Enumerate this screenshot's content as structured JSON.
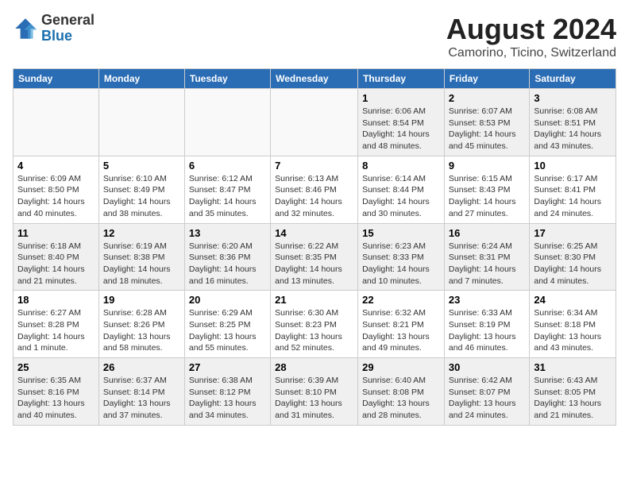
{
  "logo": {
    "general": "General",
    "blue": "Blue"
  },
  "title": "August 2024",
  "location": "Camorino, Ticino, Switzerland",
  "weekdays": [
    "Sunday",
    "Monday",
    "Tuesday",
    "Wednesday",
    "Thursday",
    "Friday",
    "Saturday"
  ],
  "weeks": [
    [
      {
        "day": "",
        "info": ""
      },
      {
        "day": "",
        "info": ""
      },
      {
        "day": "",
        "info": ""
      },
      {
        "day": "",
        "info": ""
      },
      {
        "day": "1",
        "info": "Sunrise: 6:06 AM\nSunset: 8:54 PM\nDaylight: 14 hours\nand 48 minutes."
      },
      {
        "day": "2",
        "info": "Sunrise: 6:07 AM\nSunset: 8:53 PM\nDaylight: 14 hours\nand 45 minutes."
      },
      {
        "day": "3",
        "info": "Sunrise: 6:08 AM\nSunset: 8:51 PM\nDaylight: 14 hours\nand 43 minutes."
      }
    ],
    [
      {
        "day": "4",
        "info": "Sunrise: 6:09 AM\nSunset: 8:50 PM\nDaylight: 14 hours\nand 40 minutes."
      },
      {
        "day": "5",
        "info": "Sunrise: 6:10 AM\nSunset: 8:49 PM\nDaylight: 14 hours\nand 38 minutes."
      },
      {
        "day": "6",
        "info": "Sunrise: 6:12 AM\nSunset: 8:47 PM\nDaylight: 14 hours\nand 35 minutes."
      },
      {
        "day": "7",
        "info": "Sunrise: 6:13 AM\nSunset: 8:46 PM\nDaylight: 14 hours\nand 32 minutes."
      },
      {
        "day": "8",
        "info": "Sunrise: 6:14 AM\nSunset: 8:44 PM\nDaylight: 14 hours\nand 30 minutes."
      },
      {
        "day": "9",
        "info": "Sunrise: 6:15 AM\nSunset: 8:43 PM\nDaylight: 14 hours\nand 27 minutes."
      },
      {
        "day": "10",
        "info": "Sunrise: 6:17 AM\nSunset: 8:41 PM\nDaylight: 14 hours\nand 24 minutes."
      }
    ],
    [
      {
        "day": "11",
        "info": "Sunrise: 6:18 AM\nSunset: 8:40 PM\nDaylight: 14 hours\nand 21 minutes."
      },
      {
        "day": "12",
        "info": "Sunrise: 6:19 AM\nSunset: 8:38 PM\nDaylight: 14 hours\nand 18 minutes."
      },
      {
        "day": "13",
        "info": "Sunrise: 6:20 AM\nSunset: 8:36 PM\nDaylight: 14 hours\nand 16 minutes."
      },
      {
        "day": "14",
        "info": "Sunrise: 6:22 AM\nSunset: 8:35 PM\nDaylight: 14 hours\nand 13 minutes."
      },
      {
        "day": "15",
        "info": "Sunrise: 6:23 AM\nSunset: 8:33 PM\nDaylight: 14 hours\nand 10 minutes."
      },
      {
        "day": "16",
        "info": "Sunrise: 6:24 AM\nSunset: 8:31 PM\nDaylight: 14 hours\nand 7 minutes."
      },
      {
        "day": "17",
        "info": "Sunrise: 6:25 AM\nSunset: 8:30 PM\nDaylight: 14 hours\nand 4 minutes."
      }
    ],
    [
      {
        "day": "18",
        "info": "Sunrise: 6:27 AM\nSunset: 8:28 PM\nDaylight: 14 hours\nand 1 minute."
      },
      {
        "day": "19",
        "info": "Sunrise: 6:28 AM\nSunset: 8:26 PM\nDaylight: 13 hours\nand 58 minutes."
      },
      {
        "day": "20",
        "info": "Sunrise: 6:29 AM\nSunset: 8:25 PM\nDaylight: 13 hours\nand 55 minutes."
      },
      {
        "day": "21",
        "info": "Sunrise: 6:30 AM\nSunset: 8:23 PM\nDaylight: 13 hours\nand 52 minutes."
      },
      {
        "day": "22",
        "info": "Sunrise: 6:32 AM\nSunset: 8:21 PM\nDaylight: 13 hours\nand 49 minutes."
      },
      {
        "day": "23",
        "info": "Sunrise: 6:33 AM\nSunset: 8:19 PM\nDaylight: 13 hours\nand 46 minutes."
      },
      {
        "day": "24",
        "info": "Sunrise: 6:34 AM\nSunset: 8:18 PM\nDaylight: 13 hours\nand 43 minutes."
      }
    ],
    [
      {
        "day": "25",
        "info": "Sunrise: 6:35 AM\nSunset: 8:16 PM\nDaylight: 13 hours\nand 40 minutes."
      },
      {
        "day": "26",
        "info": "Sunrise: 6:37 AM\nSunset: 8:14 PM\nDaylight: 13 hours\nand 37 minutes."
      },
      {
        "day": "27",
        "info": "Sunrise: 6:38 AM\nSunset: 8:12 PM\nDaylight: 13 hours\nand 34 minutes."
      },
      {
        "day": "28",
        "info": "Sunrise: 6:39 AM\nSunset: 8:10 PM\nDaylight: 13 hours\nand 31 minutes."
      },
      {
        "day": "29",
        "info": "Sunrise: 6:40 AM\nSunset: 8:08 PM\nDaylight: 13 hours\nand 28 minutes."
      },
      {
        "day": "30",
        "info": "Sunrise: 6:42 AM\nSunset: 8:07 PM\nDaylight: 13 hours\nand 24 minutes."
      },
      {
        "day": "31",
        "info": "Sunrise: 6:43 AM\nSunset: 8:05 PM\nDaylight: 13 hours\nand 21 minutes."
      }
    ]
  ]
}
